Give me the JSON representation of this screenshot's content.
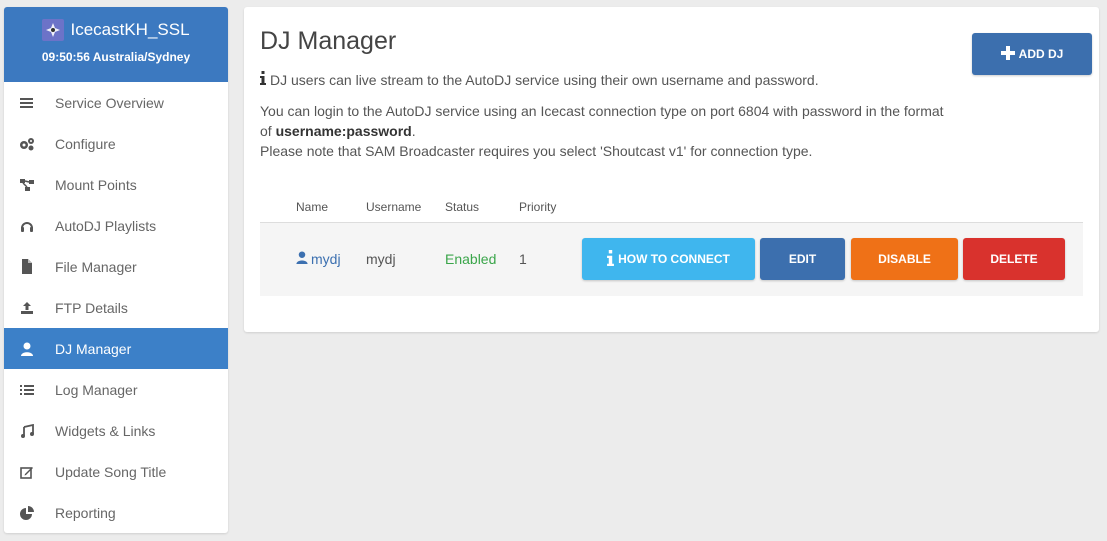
{
  "sidebar": {
    "server_name": "IcecastKH_SSL",
    "server_time": "09:50:56 Australia/Sydney",
    "items": [
      {
        "label": "Service Overview",
        "icon": "list-icon"
      },
      {
        "label": "Configure",
        "icon": "gears-icon"
      },
      {
        "label": "Mount Points",
        "icon": "sitemap-icon"
      },
      {
        "label": "AutoDJ Playlists",
        "icon": "headphones-icon"
      },
      {
        "label": "File Manager",
        "icon": "file-icon"
      },
      {
        "label": "FTP Details",
        "icon": "upload-icon"
      },
      {
        "label": "DJ Manager",
        "icon": "user-icon",
        "active": true
      },
      {
        "label": "Log Manager",
        "icon": "list-ul-icon"
      },
      {
        "label": "Widgets & Links",
        "icon": "music-icon"
      },
      {
        "label": "Update Song Title",
        "icon": "edit-icon"
      },
      {
        "label": "Reporting",
        "icon": "pie-chart-icon"
      }
    ]
  },
  "main": {
    "title": "DJ Manager",
    "add_button": "ADD DJ",
    "info": "DJ users can live stream to the AutoDJ service using their own username and password.",
    "para_line1": "You can login to the AutoDJ service using an Icecast connection type on port 6804 with password in the format",
    "para_of": "of ",
    "para_bold": "username:password",
    "para_period": ".",
    "para_line3": "Please note that SAM Broadcaster requires you select 'Shoutcast v1' for connection type."
  },
  "table": {
    "headers": {
      "name": "Name",
      "username": "Username",
      "status": "Status",
      "priority": "Priority"
    },
    "rows": [
      {
        "name": "mydj",
        "username": "mydj",
        "status": "Enabled",
        "priority": "1"
      }
    ],
    "actions": {
      "connect": "HOW TO CONNECT",
      "edit": "EDIT",
      "disable": "DISABLE",
      "delete": "DELETE"
    }
  },
  "colors": {
    "primary": "#3c79c0",
    "info": "#3fb6ee",
    "warning": "#ef7117",
    "danger": "#d9322d",
    "success": "#3aa54a"
  }
}
